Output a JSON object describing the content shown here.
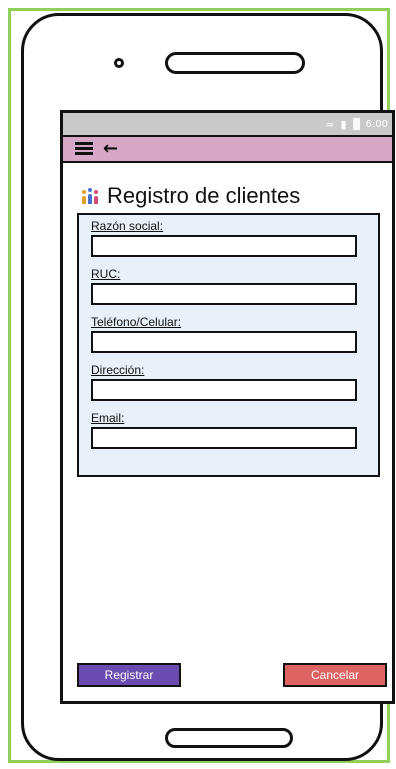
{
  "status_bar": {
    "time": "6:00",
    "wifi_icon": "wifi-icon",
    "signal_icon": "signal-icon",
    "battery_icon": "battery-icon"
  },
  "top_bar": {
    "menu_icon": "hamburger-menu-icon",
    "back_icon": "back-arrow-icon",
    "color": "#d6a7c7"
  },
  "page": {
    "title": "Registro de clientes",
    "title_icon": "people-group-icon"
  },
  "form": {
    "background": "#e8f0fa",
    "fields": [
      {
        "label": "Razón social:",
        "value": ""
      },
      {
        "label": "RUC:",
        "value": ""
      },
      {
        "label": "Teléfono/Celular:",
        "value": ""
      },
      {
        "label": "Dirección:",
        "value": ""
      },
      {
        "label": "Email:",
        "value": ""
      }
    ]
  },
  "actions": {
    "register_label": "Registrar",
    "register_color": "#6b4bb0",
    "cancel_label": "Cancelar",
    "cancel_color": "#de6363"
  }
}
